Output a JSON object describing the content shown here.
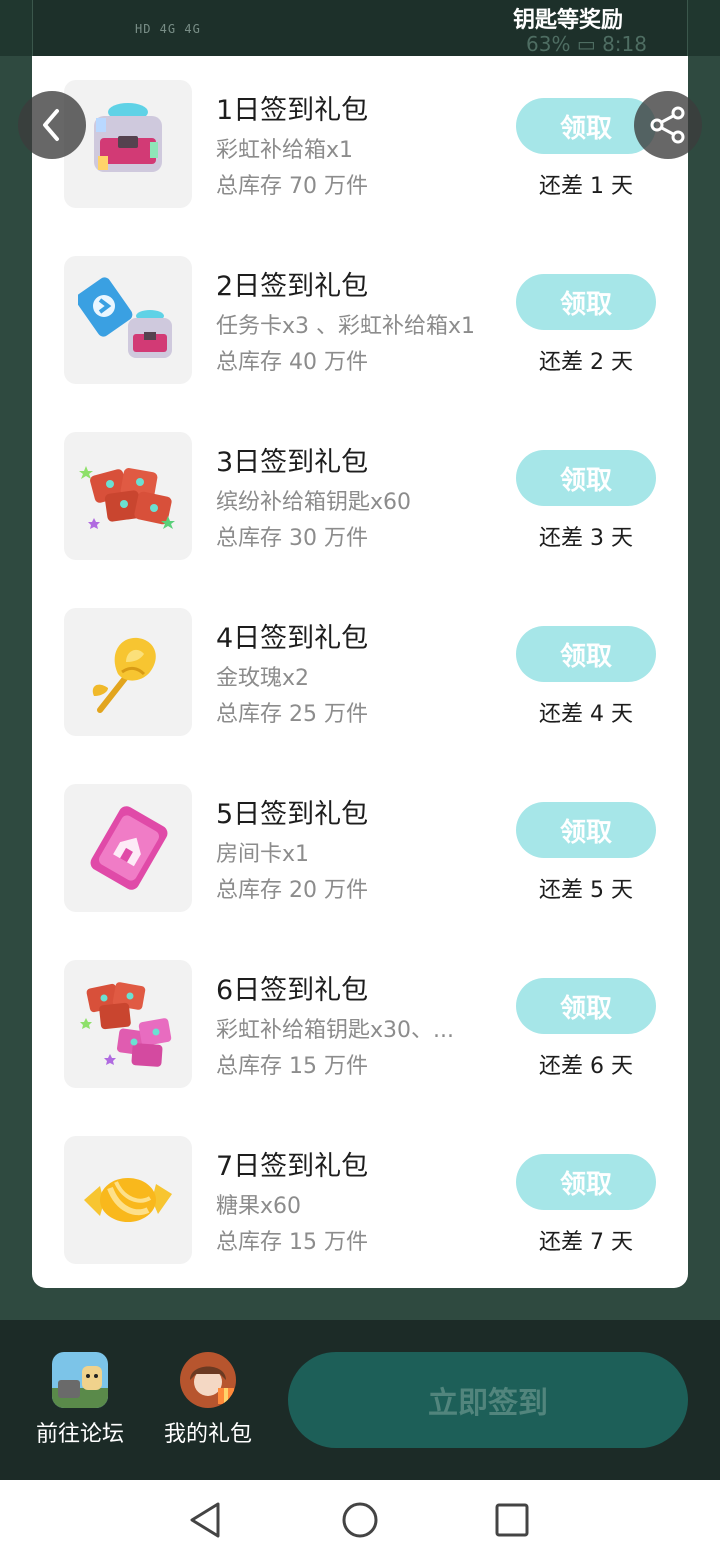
{
  "status_bar": {
    "signal_text": "HD 4G 4G",
    "battery_text": "63%",
    "time": "8:18"
  },
  "promo_text": "钥匙等奖励",
  "gifts": [
    {
      "title": "1日签到礼包",
      "desc": "彩虹补给箱x1",
      "stock": "总库存 70 万件",
      "claim_label": "领取",
      "remain": "还差 1 天",
      "icon": "rainbow-supply-box-icon"
    },
    {
      "title": "2日签到礼包",
      "desc": "任务卡x3 、彩虹补给箱x1",
      "stock": "总库存 40 万件",
      "claim_label": "领取",
      "remain": "还差 2 天",
      "icon": "task-card-and-box-icon"
    },
    {
      "title": "3日签到礼包",
      "desc": "缤纷补给箱钥匙x60",
      "stock": "总库存 30 万件",
      "claim_label": "领取",
      "remain": "还差 3 天",
      "icon": "colorful-keys-icon"
    },
    {
      "title": "4日签到礼包",
      "desc": "金玫瑰x2",
      "stock": "总库存 25 万件",
      "claim_label": "领取",
      "remain": "还差 4 天",
      "icon": "golden-rose-icon"
    },
    {
      "title": "5日签到礼包",
      "desc": "房间卡x1",
      "stock": "总库存 20 万件",
      "claim_label": "领取",
      "remain": "还差 5 天",
      "icon": "room-card-icon"
    },
    {
      "title": "6日签到礼包",
      "desc": "彩虹补给箱钥匙x30、...",
      "stock": "总库存 15 万件",
      "claim_label": "领取",
      "remain": "还差 6 天",
      "icon": "rainbow-keys-icon"
    },
    {
      "title": "7日签到礼包",
      "desc": "糖果x60",
      "stock": "总库存 15 万件",
      "claim_label": "领取",
      "remain": "还差 7 天",
      "icon": "candy-icon"
    }
  ],
  "bottom_nav": {
    "forum_label": "前往论坛",
    "my_gifts_label": "我的礼包",
    "signin_label": "立即签到"
  },
  "colors": {
    "claim_button": "#a6e6e8",
    "signin_button": "#1d5f58",
    "background": "#2f4a40"
  }
}
